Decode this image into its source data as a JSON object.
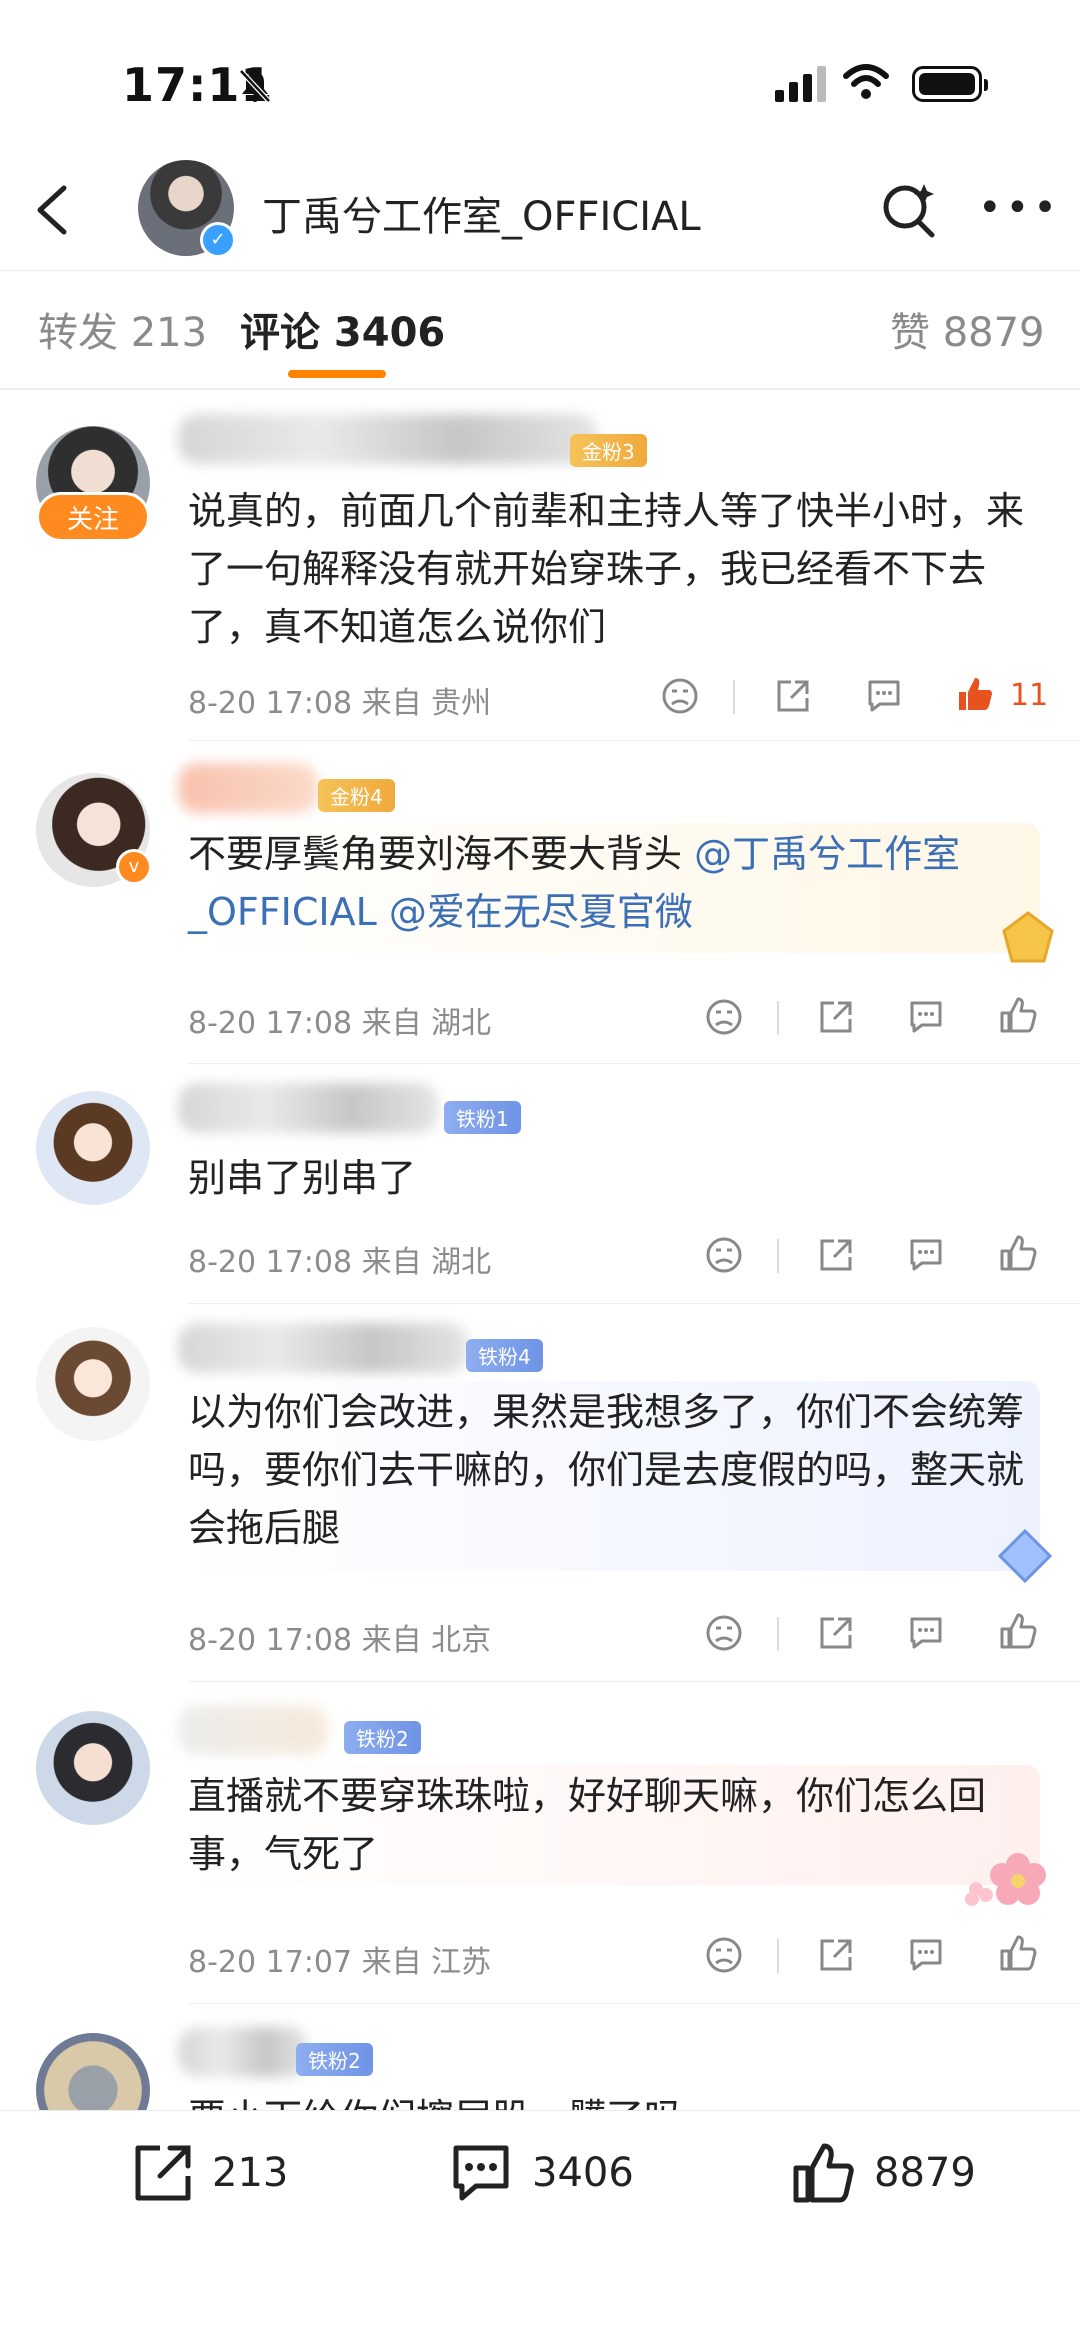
{
  "status_bar": {
    "time": "17:11"
  },
  "header": {
    "title": "丁禹兮工作室_OFFICIAL"
  },
  "tabs": [
    {
      "label": "转发 213"
    },
    {
      "label": "评论 3406"
    },
    {
      "label": "赞 8879"
    }
  ],
  "comments": [
    {
      "fan_badge": "金粉3",
      "follow_label": "关注",
      "text": "说真的，前面几个前辈和主持人等了快半小时，来了一句解释没有就开始穿珠子，我已经看不下去了，真不知道怎么说你们",
      "meta": "8-20 17:08  来自 贵州",
      "likes": "11"
    },
    {
      "fan_badge": "金粉4",
      "text_plain": "不要厚鬓角要刘海不要大背头 ",
      "mention1": "@丁禹兮工作室_OFFICIAL",
      "mention2": " @爱在无尽夏官微",
      "meta": "8-20 17:08  来自 湖北"
    },
    {
      "fan_badge": "铁粉1",
      "text": "别串了别串了",
      "meta": "8-20 17:08  来自 湖北"
    },
    {
      "fan_badge": "铁粉4",
      "text": "以为你们会改进，果然是我想多了，你们不会统筹吗，要你们去干嘛的，你们是去度假的吗，整天就会拖后腿",
      "meta": "8-20 17:08  来自 北京"
    },
    {
      "fan_badge": "铁粉2",
      "text": "直播就不要穿珠珠啦，好好聊天嘛，你们怎么回事，气死了",
      "meta": "8-20 17:07  来自 江苏"
    },
    {
      "fan_badge": "铁粉2",
      "text": "要小下给你们擦屁股，髒了吗"
    }
  ],
  "bottom_bar": {
    "repost_count": "213",
    "comment_count": "3406",
    "like_count": "8879"
  },
  "colors": {
    "accent": "#ff8200",
    "mention": "#3b6fb6",
    "like_active": "#e8521e"
  },
  "icons": [
    "back-icon",
    "search-icon",
    "more-icon",
    "dislike-icon",
    "share-icon",
    "comment-icon",
    "like-icon",
    "repost-icon"
  ]
}
